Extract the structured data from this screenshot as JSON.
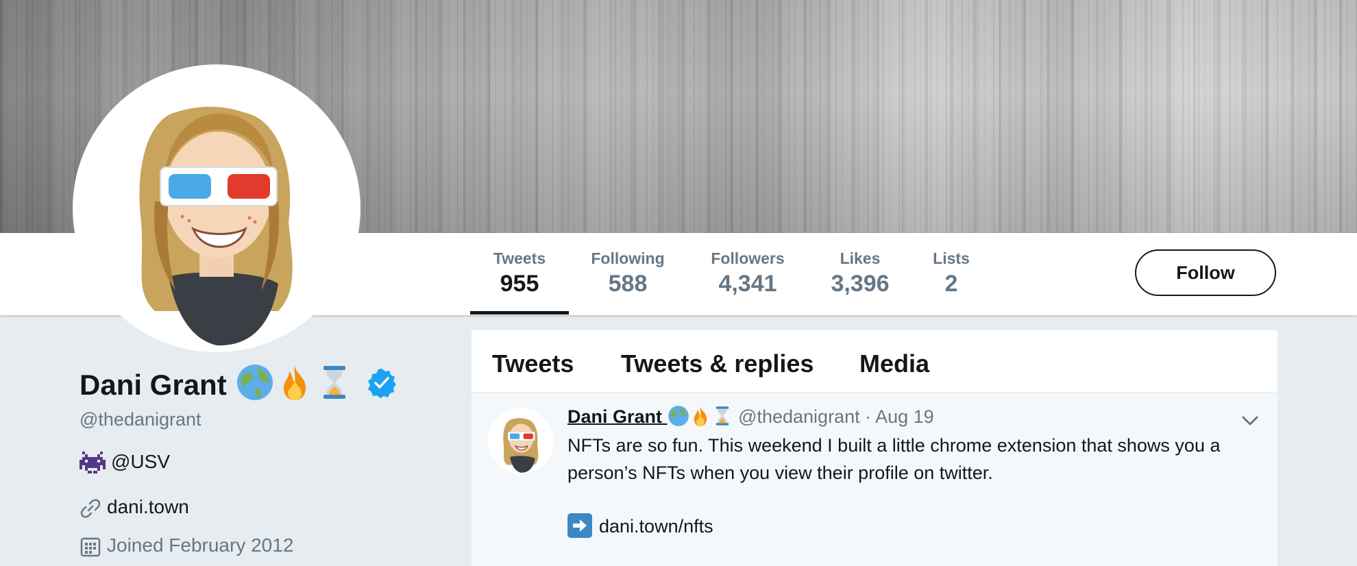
{
  "profile": {
    "name": "Dani Grant",
    "handle": "@thedanigrant",
    "name_emojis": [
      "globe-icon",
      "fire-icon",
      "hourglass-icon"
    ],
    "verified": true,
    "bio_mention": "@USV",
    "website": "dani.town",
    "joined": "Joined February 2012"
  },
  "stats": [
    {
      "label": "Tweets",
      "value": "955"
    },
    {
      "label": "Following",
      "value": "588"
    },
    {
      "label": "Followers",
      "value": "4,341"
    },
    {
      "label": "Likes",
      "value": "3,396"
    },
    {
      "label": "Lists",
      "value": "2"
    }
  ],
  "follow_label": "Follow",
  "tabs": [
    {
      "label": "Tweets"
    },
    {
      "label": "Tweets & replies"
    },
    {
      "label": "Media"
    }
  ],
  "tweet": {
    "author": "Dani Grant",
    "handle_date": "@thedanigrant · Aug 19",
    "text": "NFTs are so fun. This weekend I built a little chrome extension that shows you a person’s NFTs when you view their profile on twitter.",
    "link": "dani.town/nfts"
  },
  "colors": {
    "background": "#e6ecf0",
    "verified": "#1da1f2",
    "muted_text": "#657786",
    "primary_text": "#14171a"
  }
}
